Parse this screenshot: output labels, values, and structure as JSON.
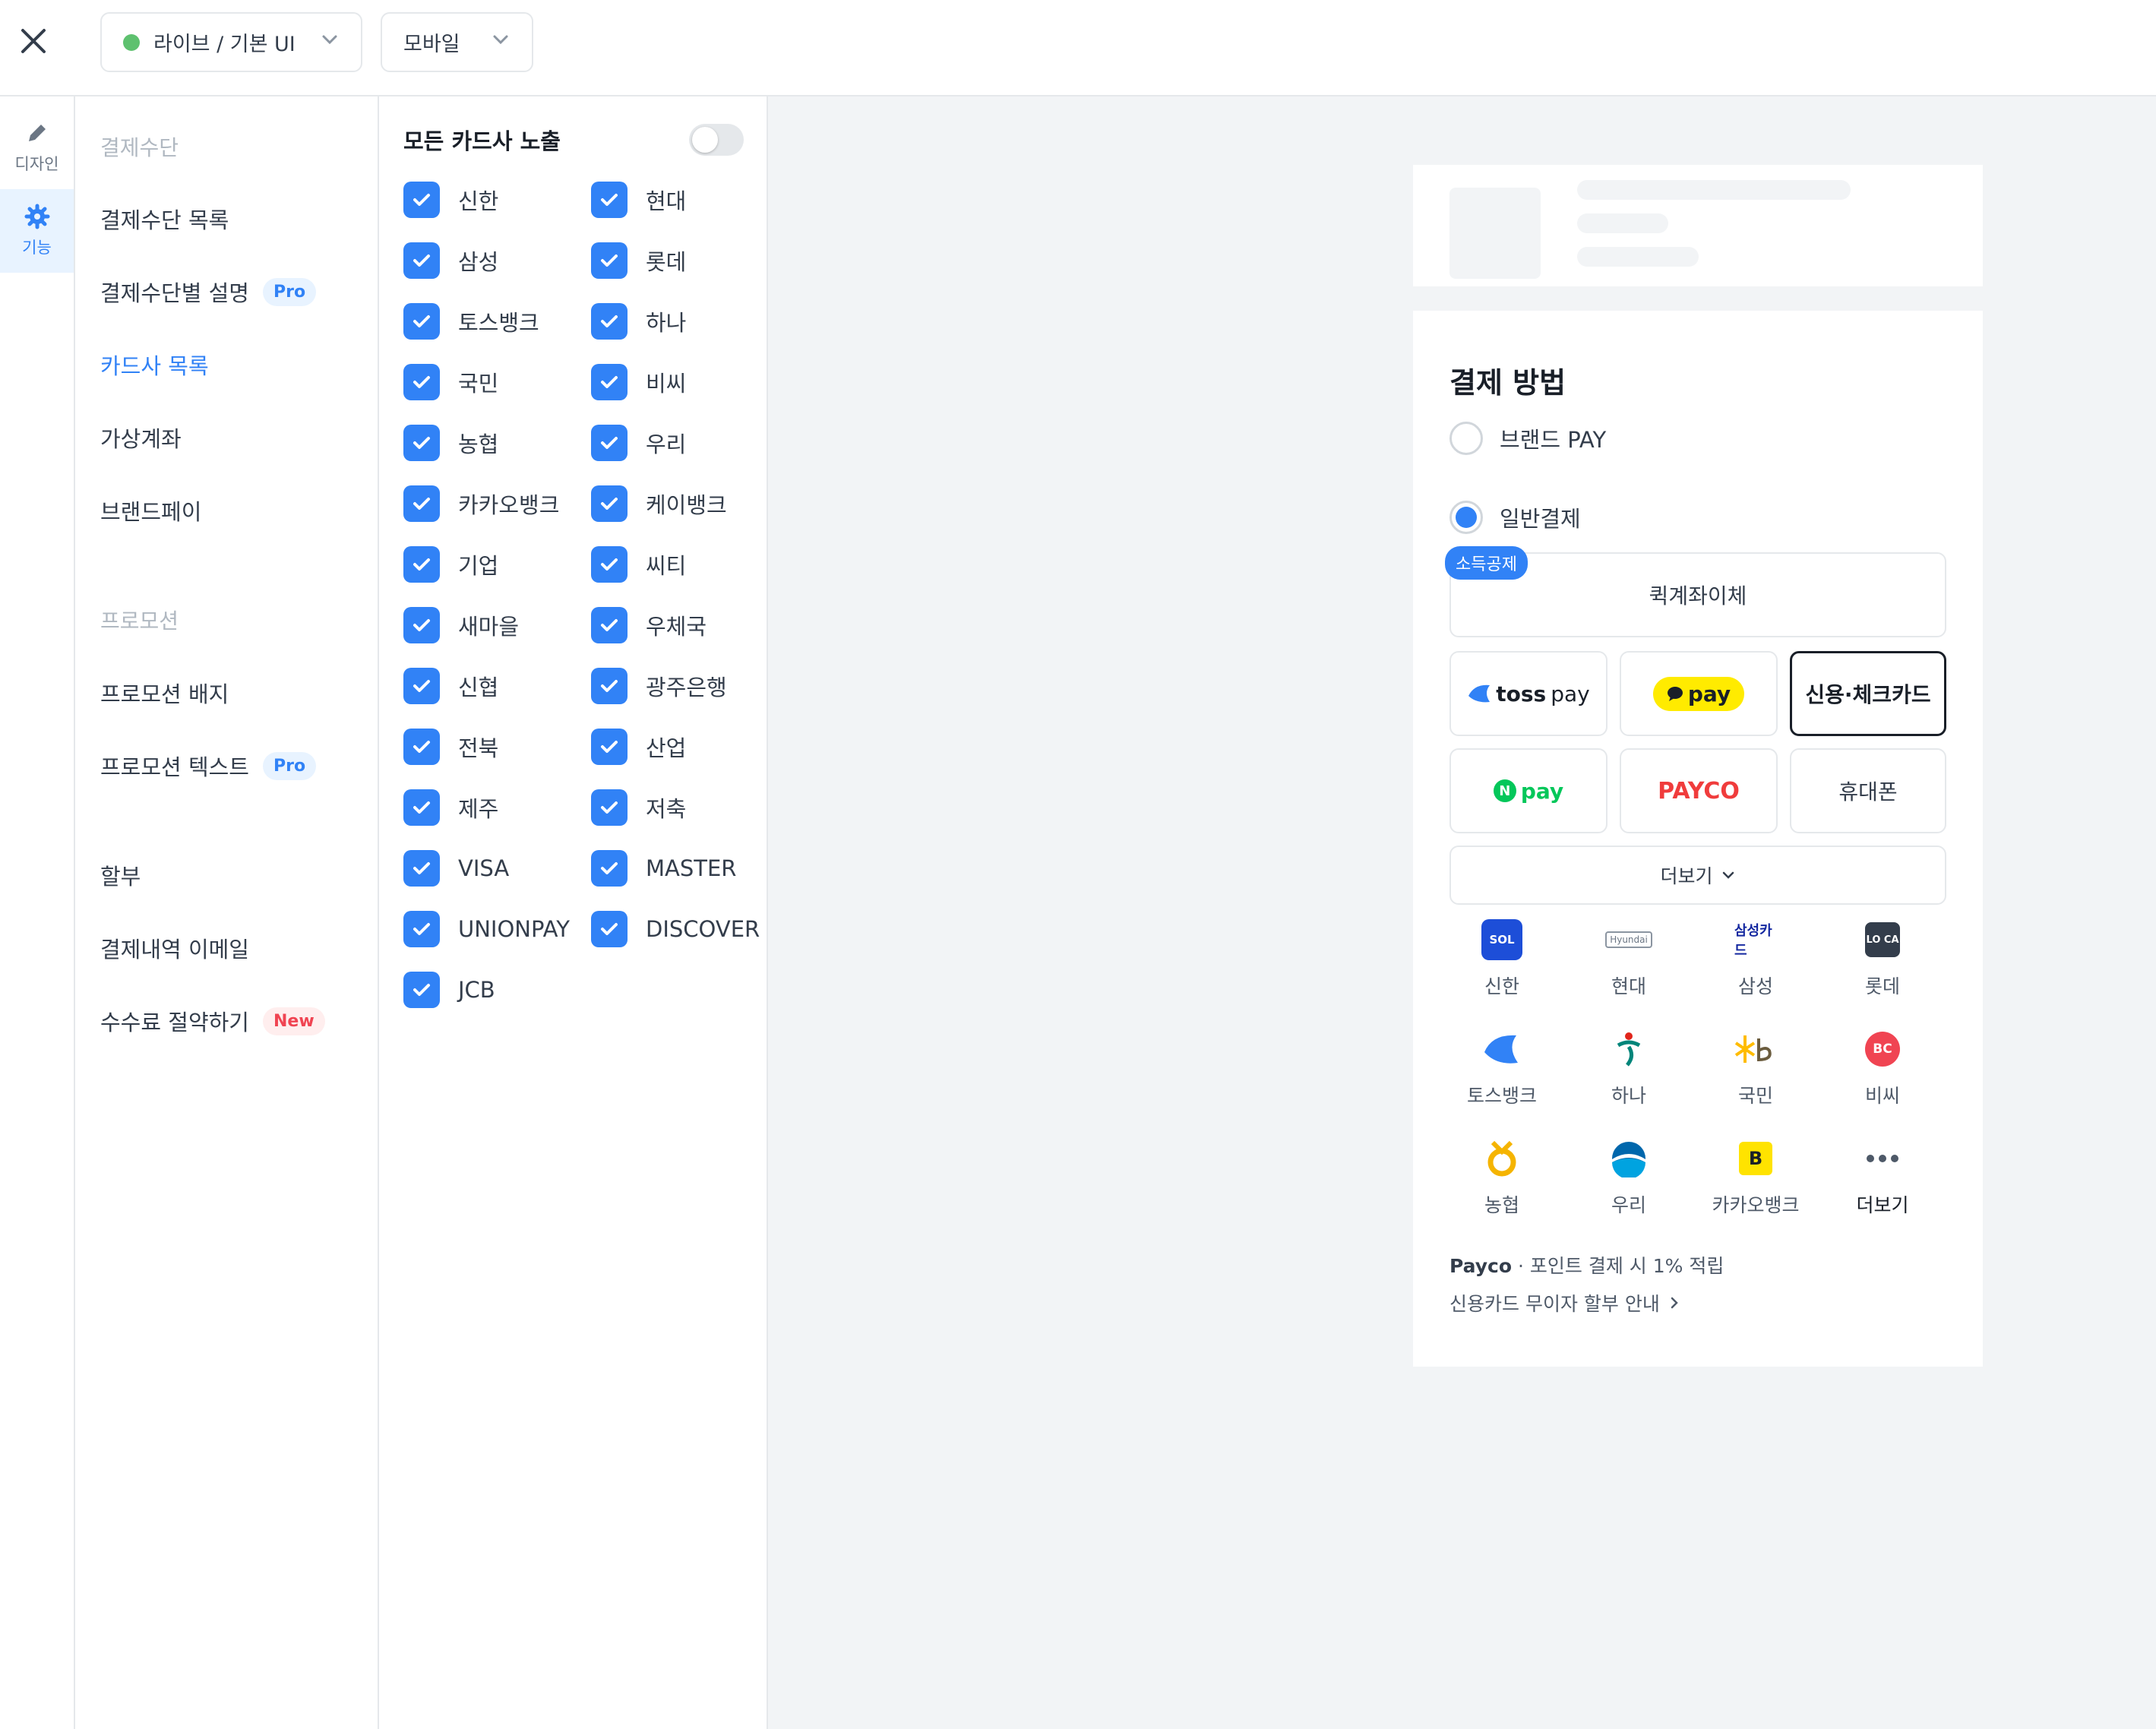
{
  "topbar": {
    "mode_label": "라이브 / 기본 UI",
    "device_label": "모바일"
  },
  "rail": {
    "design_label": "디자인",
    "function_label": "기능"
  },
  "menu": {
    "section1": "결제수단",
    "items1": [
      "결제수단 목록",
      "결제수단별 설명",
      "카드사 목록",
      "가상계좌",
      "브랜드페이"
    ],
    "section2": "프로모션",
    "items2": [
      "프로모션 배지",
      "프로모션 텍스트"
    ],
    "items3": [
      "할부",
      "결제내역 이메일",
      "수수료 절약하기"
    ],
    "badge_pro": "Pro",
    "badge_new": "New"
  },
  "cards": {
    "title": "모든 카드사 노출",
    "left": [
      "신한",
      "삼성",
      "토스뱅크",
      "국민",
      "농협",
      "카카오뱅크",
      "기업",
      "새마을",
      "신협",
      "전북",
      "제주",
      "VISA",
      "UNIONPAY",
      "JCB"
    ],
    "right": [
      "현대",
      "롯데",
      "하나",
      "비씨",
      "우리",
      "케이뱅크",
      "씨티",
      "우체국",
      "광주은행",
      "산업",
      "저축",
      "MASTER",
      "DISCOVER"
    ]
  },
  "payment": {
    "title": "결제 방법",
    "brand_pay": "브랜드 PAY",
    "general": "일반결제",
    "tag": "소득공제",
    "quick_transfer": "퀵계좌이체",
    "methods": {
      "toss_a": "toss",
      "toss_b": "pay",
      "kakao": "pay",
      "card": "신용·체크카드",
      "npay_n": "N",
      "npay": "pay",
      "payco": "PAYCO",
      "phone": "휴대폰"
    },
    "more": "더보기",
    "banks": [
      "신한",
      "현대",
      "삼성",
      "롯데",
      "토스뱅크",
      "하나",
      "국민",
      "비씨",
      "농협",
      "우리",
      "카카오뱅크",
      "더보기"
    ],
    "logo_text": {
      "shinhan": "SOL",
      "hyundai": "Hyundai",
      "samsung": "삼성카드",
      "lotte": "LO CA",
      "bc": "BC",
      "kakaobank": "B"
    },
    "promo_brand": "Payco",
    "promo_text": " · 포인트 결제 시 1% 적립",
    "installment": "신용카드 무이자 할부 안내"
  },
  "colors": {
    "primary": "#3182f6",
    "live_dot": "#5ec16f",
    "preview_bg": "#f2f4f6"
  }
}
